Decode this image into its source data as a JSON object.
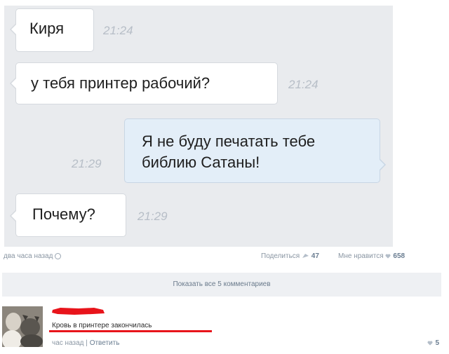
{
  "messages": [
    {
      "text": "Киря",
      "time": "21:24"
    },
    {
      "text": "у тебя принтер рабочий?",
      "time": "21:24"
    },
    {
      "line1": "Я не буду печатать тебе",
      "line2": "библию Сатаны!",
      "time": "21:29"
    },
    {
      "text": "Почему?",
      "time": "21:29"
    }
  ],
  "post": {
    "time_ago": "два часа назад",
    "share_label": "Поделиться",
    "share_count": "47",
    "like_label": "Мне нравится",
    "like_count": "658"
  },
  "comments_toggle": "Показать все 5 комментариев",
  "comment": {
    "text": "Кровь в принтере закончилась",
    "time_ago": "час назад",
    "separator": "|",
    "reply_label": "Ответить",
    "likes": "5"
  },
  "colors": {
    "redact": "#e8141b",
    "chat_bg": "#e9ebee",
    "outgoing_bubble": "#e3eef8"
  },
  "icons": [
    "gear-icon",
    "share-icon",
    "heart-icon"
  ]
}
